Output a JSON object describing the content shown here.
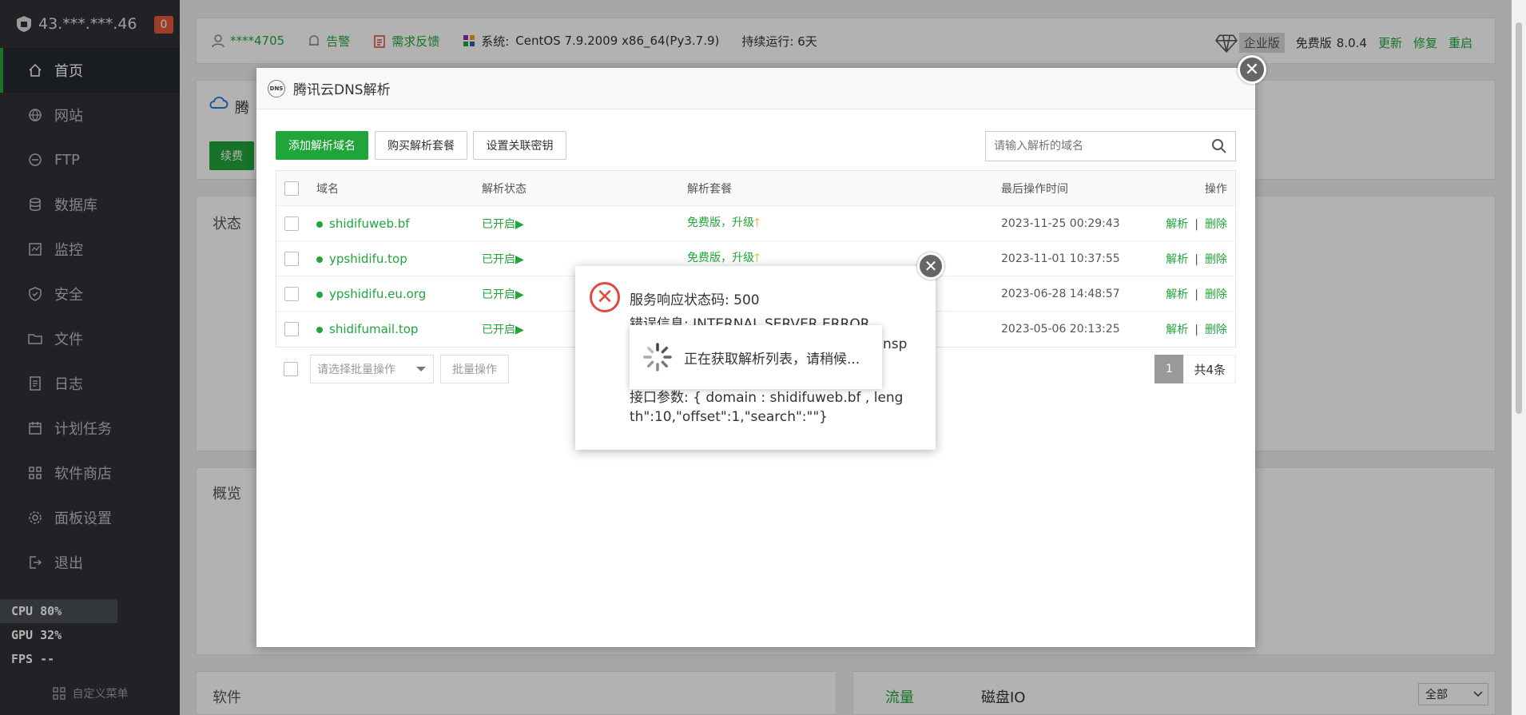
{
  "sidebar": {
    "server_ip": "43.***.***.46",
    "badge": "0",
    "items": [
      {
        "label": "首页",
        "icon": "home-icon"
      },
      {
        "label": "网站",
        "icon": "globe-icon"
      },
      {
        "label": "FTP",
        "icon": "ftp-icon"
      },
      {
        "label": "数据库",
        "icon": "database-icon"
      },
      {
        "label": "监控",
        "icon": "monitor-icon"
      },
      {
        "label": "安全",
        "icon": "shield-icon"
      },
      {
        "label": "文件",
        "icon": "folder-icon"
      },
      {
        "label": "日志",
        "icon": "log-icon"
      },
      {
        "label": "计划任务",
        "icon": "calendar-icon"
      },
      {
        "label": "软件商店",
        "icon": "apps-icon"
      },
      {
        "label": "面板设置",
        "icon": "gear-icon"
      },
      {
        "label": "退出",
        "icon": "logout-icon"
      }
    ],
    "perf": {
      "cpu": "CPU  80%",
      "gpu": "GPU  32%",
      "fps": "FPS  --"
    },
    "custom_menu": "自定义菜单"
  },
  "topbar": {
    "user": "****4705",
    "alert": "告警",
    "feedback": "需求反馈",
    "system_label": "系统:",
    "system_value": "CentOS 7.9.2009 x86_64(Py3.7.9)",
    "uptime": "持续运行: 6天",
    "edition_enterprise": "企业版",
    "edition_free": "免费版",
    "version": "8.0.4",
    "update": "更新",
    "repair": "修复",
    "restart": "重启"
  },
  "background": {
    "tencent_title": "腾",
    "renew_btn": "续费",
    "status_title": "状态",
    "overview_title": "概览",
    "software_title": "软件",
    "traffic_tab": "流量",
    "disk_tab": "磁盘IO",
    "select_all": "全部"
  },
  "modal": {
    "title": "腾讯云DNS解析",
    "icon_text": "DNS",
    "buttons": {
      "add": "添加解析域名",
      "buy": "购买解析套餐",
      "key": "设置关联密钥"
    },
    "search_placeholder": "请输入解析的域名",
    "columns": {
      "domain": "域名",
      "state": "解析状态",
      "plan": "解析套餐",
      "time": "最后操作时间",
      "ops": "操作"
    },
    "rows": [
      {
        "domain": "shidifuweb.bf",
        "state": "已开启▶",
        "plan": "免费版，升级",
        "time": "2023-11-25 00:29:43"
      },
      {
        "domain": "ypshidifu.top",
        "state": "已开启▶",
        "plan": "免费版，升级",
        "time": "2023-11-01 10:37:55"
      },
      {
        "domain": "ypshidifu.eu.org",
        "state": "已开启▶",
        "plan": "",
        "time": "2023-06-28 14:48:57"
      },
      {
        "domain": "shidifumail.top",
        "state": "已开启▶",
        "plan": "",
        "time": "2023-05-06 20:13:25"
      }
    ],
    "op_resolve": "解析",
    "op_delete": "删除",
    "batch_placeholder": "请选择批量操作",
    "batch_btn": "批量操作",
    "page": "1",
    "total": "共4条"
  },
  "error": {
    "line1": "服务响应状态码: 500",
    "line2": "错误信息: INTERNAL SERVER ERROR",
    "line3_tail": "nsp",
    "line4": "接口参数: { domain : shidifuweb.bf , leng",
    "line5": "th\":10,\"offset\":1,\"search\":\"\"}"
  },
  "loading": {
    "text": "正在获取解析列表，请稍候..."
  }
}
